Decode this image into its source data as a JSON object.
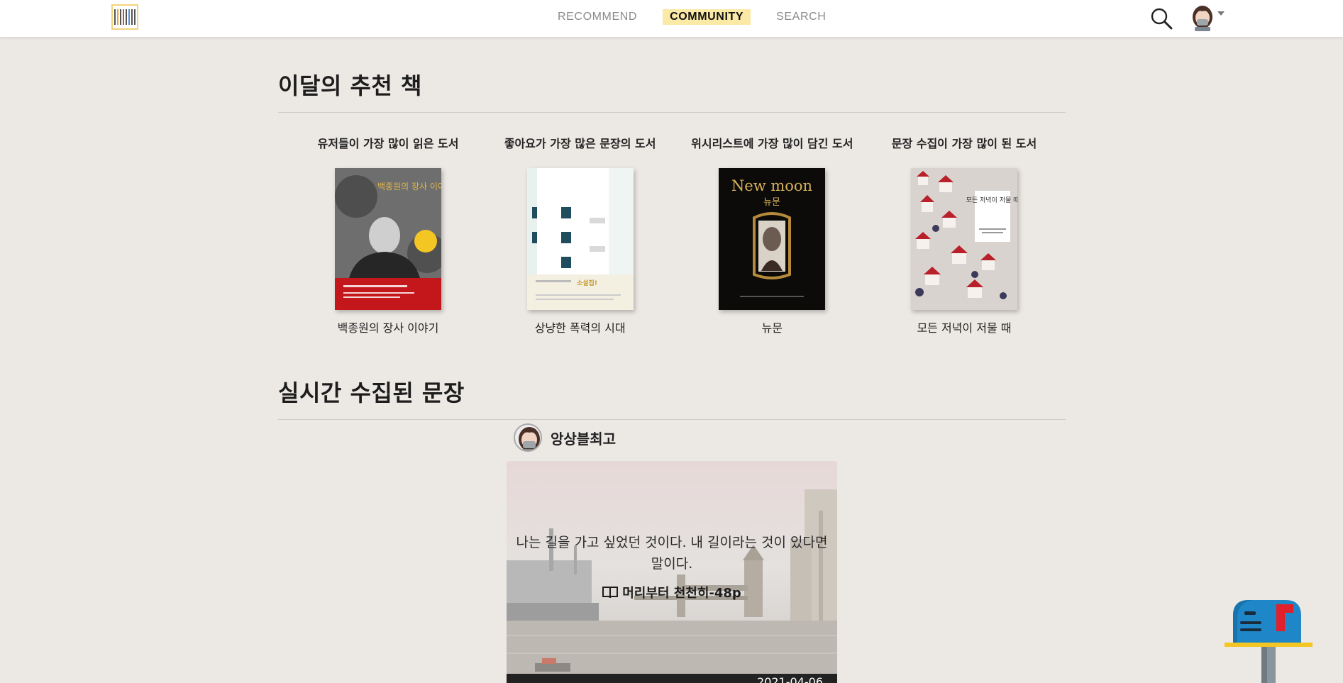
{
  "nav": {
    "items": [
      {
        "label": "RECOMMEND",
        "active": false
      },
      {
        "label": "COMMUNITY",
        "active": true
      },
      {
        "label": "SEARCH",
        "active": false
      }
    ]
  },
  "recommend": {
    "title": "이달의 추천 책",
    "books": [
      {
        "category": "유저들이 가장 많이 읽은 도서",
        "name": "백종원의 장사 이야기",
        "cover_text": "백종원의 장사 이야기"
      },
      {
        "category": "좋아요가 가장 많은 문장의 도서",
        "name": "상냥한 폭력의 시대",
        "cover_text": "소설집!"
      },
      {
        "category": "위시리스트에 가장 많이 담긴 도서",
        "name": "뉴문",
        "cover_text": "New moon",
        "cover_subtext": "뉴문"
      },
      {
        "category": "문장 수집이 가장 많이 된 도서",
        "name": "모든 저녁이 저물 때",
        "cover_text": "모든 저녁이 저물 때"
      }
    ]
  },
  "live": {
    "title": "실시간 수집된 문장",
    "post": {
      "author": "앙상블최고",
      "quote_line1": "나는 길을 가고 싶었던 것이다. 내 길이라는 것이 있다면",
      "quote_line2": "말이다.",
      "source": "머리부터 천천히-48p",
      "date": "2021-04-06"
    }
  },
  "colors": {
    "background": "#ece8e4",
    "active_nav": "#fbe9a6",
    "mailbox_blue": "#1f86c7",
    "mailbox_flag": "#e0202a"
  }
}
